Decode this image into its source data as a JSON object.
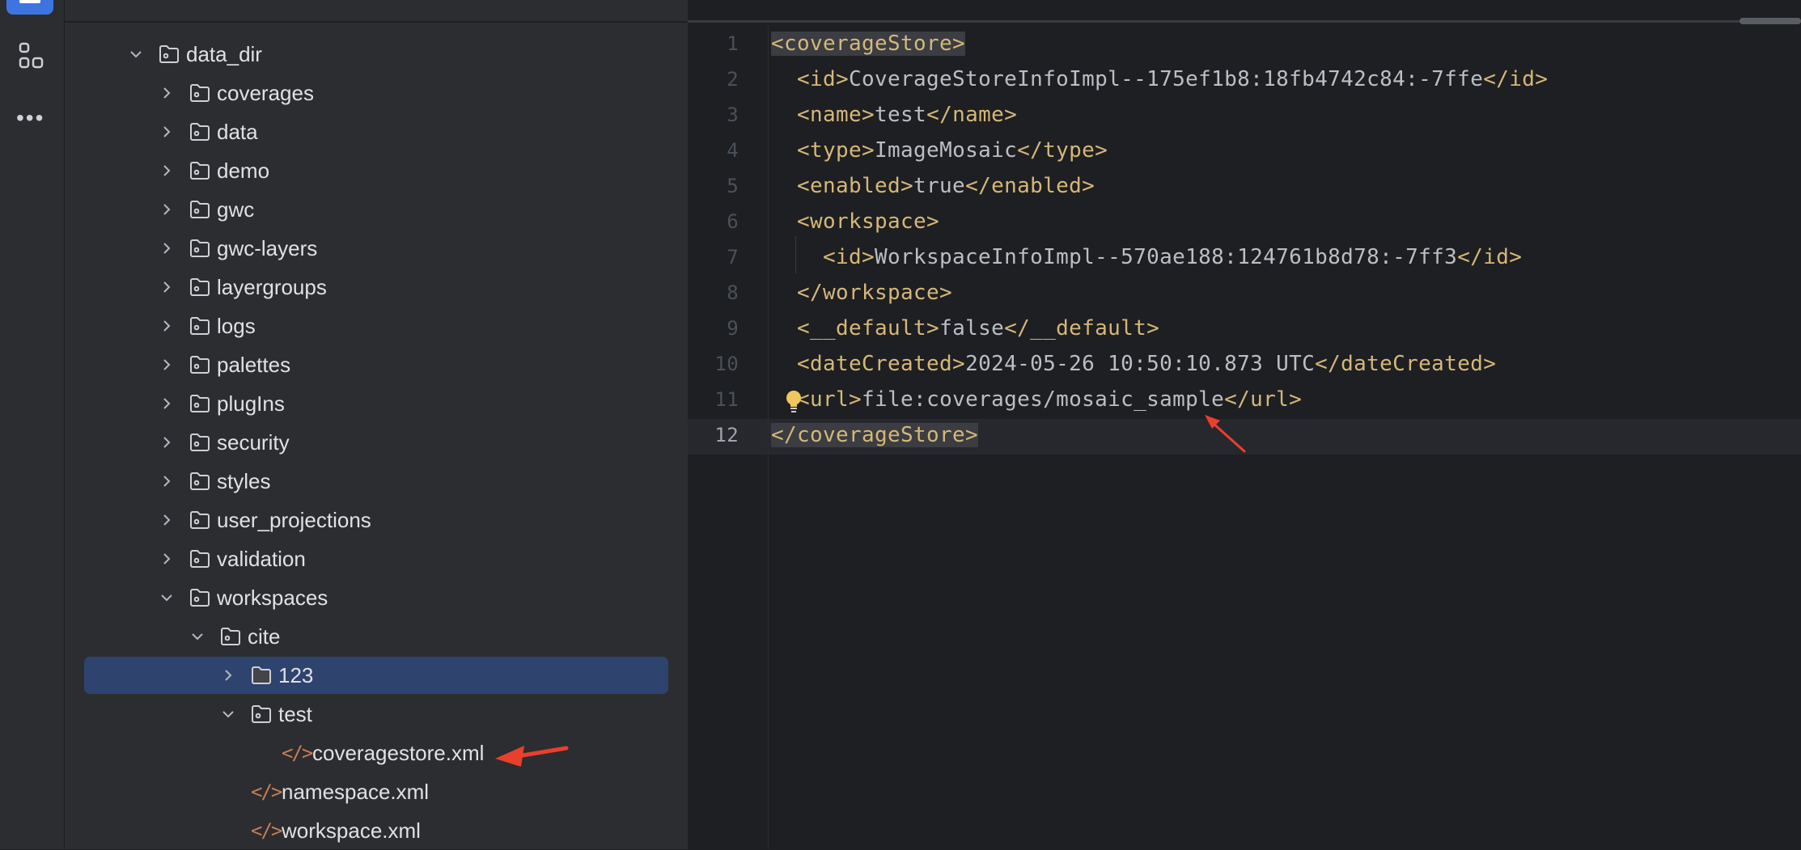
{
  "project_tree": {
    "items": [
      {
        "label": "data_dir",
        "depth": 1,
        "kind": "folder",
        "expanded": true
      },
      {
        "label": "coverages",
        "depth": 2,
        "kind": "folder",
        "expanded": false
      },
      {
        "label": "data",
        "depth": 2,
        "kind": "folder",
        "expanded": false
      },
      {
        "label": "demo",
        "depth": 2,
        "kind": "folder",
        "expanded": false
      },
      {
        "label": "gwc",
        "depth": 2,
        "kind": "folder",
        "expanded": false
      },
      {
        "label": "gwc-layers",
        "depth": 2,
        "kind": "folder",
        "expanded": false
      },
      {
        "label": "layergroups",
        "depth": 2,
        "kind": "folder",
        "expanded": false
      },
      {
        "label": "logs",
        "depth": 2,
        "kind": "folder",
        "expanded": false
      },
      {
        "label": "palettes",
        "depth": 2,
        "kind": "folder",
        "expanded": false
      },
      {
        "label": "plugIns",
        "depth": 2,
        "kind": "folder",
        "expanded": false
      },
      {
        "label": "security",
        "depth": 2,
        "kind": "folder",
        "expanded": false
      },
      {
        "label": "styles",
        "depth": 2,
        "kind": "folder",
        "expanded": false
      },
      {
        "label": "user_projections",
        "depth": 2,
        "kind": "folder",
        "expanded": false
      },
      {
        "label": "validation",
        "depth": 2,
        "kind": "folder",
        "expanded": false
      },
      {
        "label": "workspaces",
        "depth": 2,
        "kind": "folder",
        "expanded": true
      },
      {
        "label": "cite",
        "depth": 3,
        "kind": "folder",
        "expanded": true
      },
      {
        "label": "123",
        "depth": 4,
        "kind": "plain-folder",
        "expanded": false,
        "selected": true
      },
      {
        "label": "test",
        "depth": 4,
        "kind": "folder",
        "expanded": true
      },
      {
        "label": "coveragestore.xml",
        "depth": 5,
        "kind": "xml"
      },
      {
        "label": "namespace.xml",
        "depth": 4,
        "kind": "xml"
      },
      {
        "label": "workspace.xml",
        "depth": 4,
        "kind": "xml"
      }
    ]
  },
  "editor": {
    "current_line": 12,
    "lines": [
      {
        "n": "1",
        "indent": 0,
        "parts": [
          [
            "tag",
            "<coverageStore>"
          ]
        ],
        "highlight": true
      },
      {
        "n": "2",
        "indent": 2,
        "parts": [
          [
            "tag",
            "<id>"
          ],
          [
            "text",
            "CoverageStoreInfoImpl--175ef1b8:18fb4742c84:-7ffe"
          ],
          [
            "tag",
            "</id>"
          ]
        ]
      },
      {
        "n": "3",
        "indent": 2,
        "parts": [
          [
            "tag",
            "<name>"
          ],
          [
            "text",
            "test"
          ],
          [
            "tag",
            "</name>"
          ]
        ]
      },
      {
        "n": "4",
        "indent": 2,
        "parts": [
          [
            "tag",
            "<type>"
          ],
          [
            "text",
            "ImageMosaic"
          ],
          [
            "tag",
            "</type>"
          ]
        ]
      },
      {
        "n": "5",
        "indent": 2,
        "parts": [
          [
            "tag",
            "<enabled>"
          ],
          [
            "text",
            "true"
          ],
          [
            "tag",
            "</enabled>"
          ]
        ]
      },
      {
        "n": "6",
        "indent": 2,
        "parts": [
          [
            "tag",
            "<workspace>"
          ]
        ]
      },
      {
        "n": "7",
        "indent": 4,
        "parts": [
          [
            "tag",
            "<id>"
          ],
          [
            "text",
            "WorkspaceInfoImpl--570ae188:124761b8d78:-7ff3"
          ],
          [
            "tag",
            "</id>"
          ]
        ]
      },
      {
        "n": "8",
        "indent": 2,
        "parts": [
          [
            "tag",
            "</workspace>"
          ]
        ]
      },
      {
        "n": "9",
        "indent": 2,
        "parts": [
          [
            "tag",
            "<__default>"
          ],
          [
            "text",
            "false"
          ],
          [
            "tag",
            "</__default>"
          ]
        ]
      },
      {
        "n": "10",
        "indent": 2,
        "parts": [
          [
            "tag",
            "<dateCreated>"
          ],
          [
            "text",
            "2024-05-26 10:50:10.873 UTC"
          ],
          [
            "tag",
            "</dateCreated>"
          ]
        ]
      },
      {
        "n": "11",
        "indent": 2,
        "parts": [
          [
            "tag",
            "<url>"
          ],
          [
            "text",
            "file:coverages/mosaic_sample"
          ],
          [
            "tag",
            "</url>"
          ]
        ]
      },
      {
        "n": "12",
        "indent": 0,
        "parts": [
          [
            "tag",
            "</coverageStore>"
          ]
        ],
        "highlight": true
      }
    ]
  },
  "icons": {
    "activity": [
      "project-icon",
      "structure-icon",
      "more-icon"
    ],
    "gutter": "lightbulb-icon"
  },
  "colors": {
    "tag": "#d5b778",
    "text": "#bcbec4",
    "selection": "#2e436e",
    "annotation_arrow": "#e8402c",
    "accent": "#3d74e0"
  }
}
